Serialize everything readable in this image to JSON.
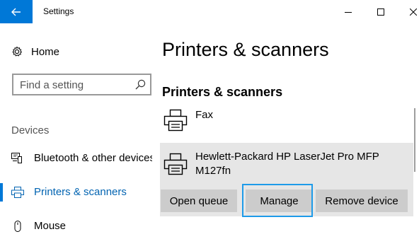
{
  "window": {
    "title": "Settings",
    "back_icon": "back-arrow-icon",
    "controls": [
      "minimize-icon",
      "maximize-icon",
      "close-icon"
    ]
  },
  "sidebar": {
    "home_label": "Home",
    "search_placeholder": "Find a setting",
    "section_label": "Devices",
    "items": [
      {
        "label": "Bluetooth & other devices",
        "icon": "bluetooth-devices-icon",
        "selected": false
      },
      {
        "label": "Printers & scanners",
        "icon": "printer-icon",
        "selected": true
      },
      {
        "label": "Mouse",
        "icon": "mouse-icon",
        "selected": false
      }
    ]
  },
  "main": {
    "page_title": "Printers & scanners",
    "section_title": "Printers & scanners",
    "printers": [
      {
        "name": "Fax",
        "icon": "printer-icon"
      },
      {
        "name": "Hewlett-Packard HP LaserJet Pro MFP M127fn",
        "icon": "printer-icon",
        "selected": true
      }
    ],
    "actions": {
      "open_queue": "Open queue",
      "manage": "Manage",
      "remove_device": "Remove device"
    }
  },
  "colors": {
    "accent": "#0078d7",
    "selected_text": "#0063b1",
    "highlight_frame": "#1e9be9",
    "button_bg": "#cccccc",
    "selected_row_bg": "#e6e6e6"
  }
}
